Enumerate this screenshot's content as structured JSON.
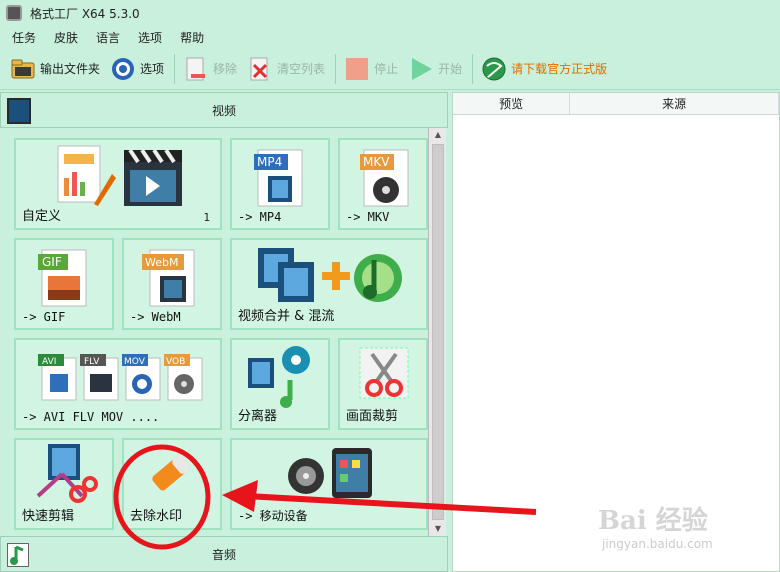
{
  "app": {
    "title": "格式工厂 X64 5.3.0"
  },
  "menu": {
    "items": [
      "任务",
      "皮肤",
      "语言",
      "选项",
      "帮助"
    ]
  },
  "toolbar": {
    "output_folder": "输出文件夹",
    "options": "选项",
    "remove": "移除",
    "clear_list": "清空列表",
    "stop": "停止",
    "start": "开始",
    "download_official": "请下载官方正式版"
  },
  "left": {
    "video_header": "视频",
    "audio_header": "音频",
    "tiles": [
      {
        "id": "custom",
        "label": "自定义",
        "count": "1"
      },
      {
        "id": "mp4",
        "label": "-> MP4",
        "badge": "MP4"
      },
      {
        "id": "mkv",
        "label": "-> MKV",
        "badge": "MKV"
      },
      {
        "id": "gif",
        "label": "-> GIF",
        "badge": "GIF"
      },
      {
        "id": "webm",
        "label": "-> WebM",
        "badge": "WebM"
      },
      {
        "id": "merge",
        "label": "视频合并 & 混流"
      },
      {
        "id": "multi",
        "label": "-> AVI FLV MOV ....",
        "badges": [
          "AVI",
          "FLV",
          "MOV",
          "VOB"
        ]
      },
      {
        "id": "splitter",
        "label": "分离器"
      },
      {
        "id": "crop",
        "label": "画面裁剪"
      },
      {
        "id": "quickcut",
        "label": "快速剪辑"
      },
      {
        "id": "watermark",
        "label": "去除水印"
      },
      {
        "id": "mobile",
        "label": "-> 移动设备"
      }
    ]
  },
  "right": {
    "columns": [
      "预览",
      "来源"
    ]
  },
  "watermark": {
    "brand": "Bai 经验",
    "url": "jingyan.baidu.com"
  },
  "colors": {
    "accent": "#2f9e5a",
    "annotation": "#e8141c",
    "download": "#e06c00"
  }
}
